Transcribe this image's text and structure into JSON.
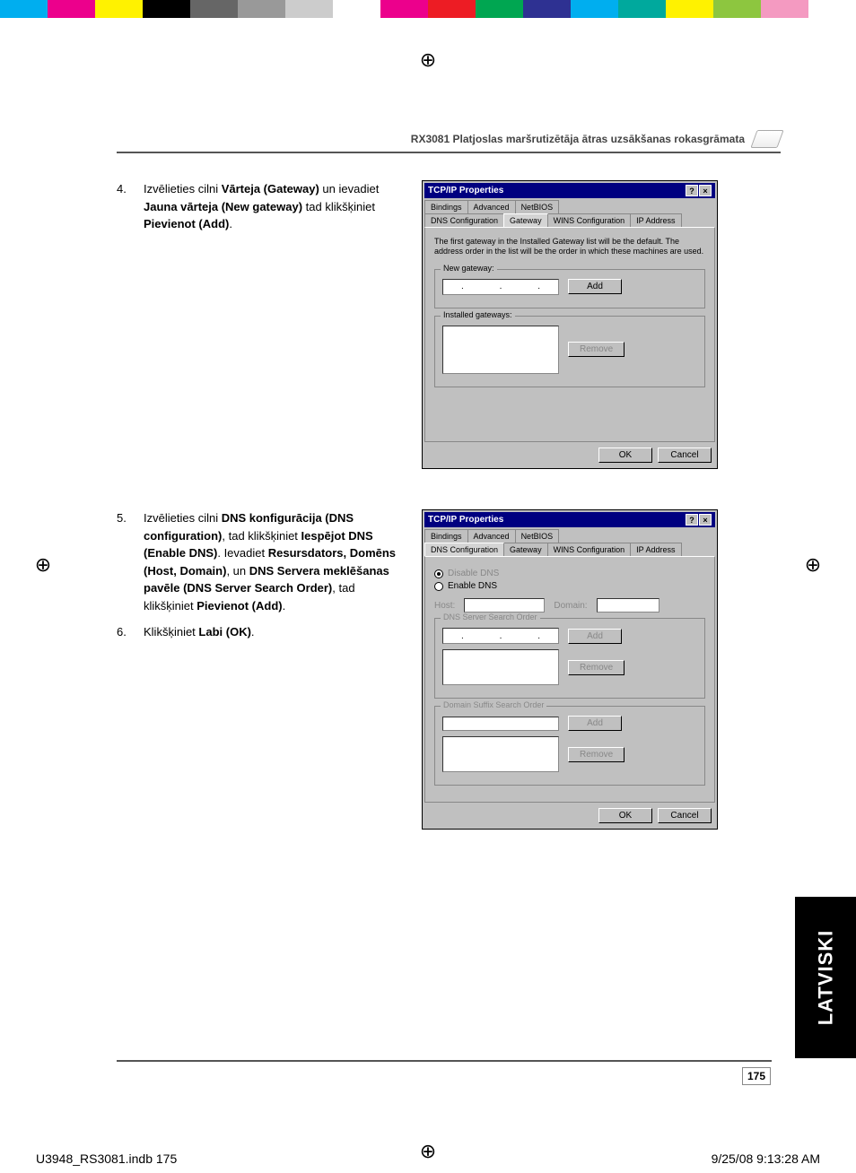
{
  "color_bar": [
    "#00AEEF",
    "#EC008C",
    "#FFF200",
    "#000000",
    "#666666",
    "#999999",
    "#CCCCCC",
    "#FFFFFF",
    "#EC008C",
    "#ED1C24",
    "#00A651",
    "#2E3192",
    "#00AEEF",
    "#00A99D",
    "#FFF200",
    "#8DC63F",
    "#F49AC1",
    "#FFFFFF"
  ],
  "header_title": "RX3081 Platjoslas maršrutizētāja ātras uzsākšanas rokasgrāmata",
  "steps": [
    {
      "num": "4.",
      "parts": [
        {
          "t": "Izvēlieties cilni ",
          "b": false
        },
        {
          "t": "Vārteja (Gateway)",
          "b": true
        },
        {
          "t": " un ievadiet ",
          "b": false
        },
        {
          "t": "Jauna vārteja (New gateway)",
          "b": true
        },
        {
          "t": " tad klikšķiniet ",
          "b": false
        },
        {
          "t": "Pievienot (Add)",
          "b": true
        },
        {
          "t": ".",
          "b": false
        }
      ]
    },
    {
      "num": "5.",
      "parts": [
        {
          "t": "Izvēlieties cilni ",
          "b": false
        },
        {
          "t": "DNS konfigurācija (DNS configuration)",
          "b": true
        },
        {
          "t": ", tad klikšķiniet ",
          "b": false
        },
        {
          "t": "Iespējot DNS (Enable DNS)",
          "b": true
        },
        {
          "t": ". Ievadiet ",
          "b": false
        },
        {
          "t": "Resursdators, Domēns (Host, Domain)",
          "b": true
        },
        {
          "t": ", un ",
          "b": false
        },
        {
          "t": "DNS Servera meklēšanas pavēle (DNS Server Search Order)",
          "b": true
        },
        {
          "t": ", tad klikšķiniet ",
          "b": false
        },
        {
          "t": "Pievienot (Add)",
          "b": true
        },
        {
          "t": ".",
          "b": false
        }
      ]
    },
    {
      "num": "6.",
      "parts": [
        {
          "t": "Klikšķiniet ",
          "b": false
        },
        {
          "t": "Labi (OK)",
          "b": true
        },
        {
          "t": ".",
          "b": false
        }
      ]
    }
  ],
  "dialog1": {
    "title": "TCP/IP Properties",
    "help_btn": "?",
    "close_btn": "×",
    "tabs_row1": [
      "Bindings",
      "Advanced",
      "NetBIOS"
    ],
    "tabs_row2": [
      "DNS Configuration",
      "Gateway",
      "WINS Configuration",
      "IP Address"
    ],
    "active_tab": "Gateway",
    "desc": "The first gateway in the Installed Gateway list will be the default. The address order in the list will be the order in which these machines are used.",
    "new_gateway_label": "New gateway:",
    "add_btn": "Add",
    "installed_label": "Installed gateways:",
    "remove_btn": "Remove",
    "ok_btn": "OK",
    "cancel_btn": "Cancel"
  },
  "dialog2": {
    "title": "TCP/IP Properties",
    "help_btn": "?",
    "close_btn": "×",
    "tabs_row1": [
      "Bindings",
      "Advanced",
      "NetBIOS"
    ],
    "tabs_row2": [
      "DNS Configuration",
      "Gateway",
      "WINS Configuration",
      "IP Address"
    ],
    "active_tab": "DNS Configuration",
    "radio_disable": "Disable DNS",
    "radio_enable": "Enable DNS",
    "host_label": "Host:",
    "domain_label": "Domain:",
    "search_order_label": "DNS Server Search Order",
    "suffix_order_label": "Domain Suffix Search Order",
    "add_btn": "Add",
    "remove_btn": "Remove",
    "ok_btn": "OK",
    "cancel_btn": "Cancel"
  },
  "side_tab": "LATVISKI",
  "page_number": "175",
  "footer_left": "U3948_RS3081.indb   175",
  "footer_right": "9/25/08   9:13:28 AM"
}
